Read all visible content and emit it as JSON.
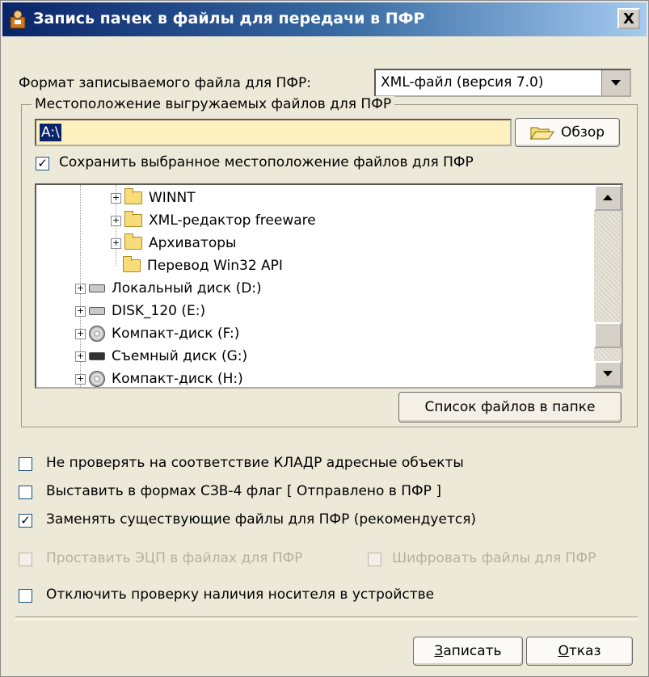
{
  "window": {
    "title": "Запись пачек в файлы для передачи в ПФР",
    "close_label": "X"
  },
  "format": {
    "label": "Формат записываемого файла для ПФР:",
    "value": "XML-файл (версия 7.0)"
  },
  "location": {
    "group_title": "Местоположение выгружаемых файлов для ПФР",
    "path_value": "A:\\",
    "browse_label": "Обзор",
    "save_location_label": "Сохранить выбранное местоположение файлов для ПФР",
    "save_location_checked": true,
    "file_list_button": "Список файлов в папке"
  },
  "tree": {
    "items": [
      {
        "label": "WINNT",
        "icon": "folder-icon",
        "expandable": true
      },
      {
        "label": "XML-редактор freeware",
        "icon": "folder-icon",
        "expandable": true
      },
      {
        "label": "Архиваторы",
        "icon": "folder-icon",
        "expandable": true
      },
      {
        "label": "Перевод Win32 API",
        "icon": "folder-icon",
        "expandable": false
      },
      {
        "label": "Локальный диск (D:)",
        "icon": "hard-drive-icon",
        "expandable": true
      },
      {
        "label": "DISK_120 (E:)",
        "icon": "hard-drive-icon",
        "expandable": true
      },
      {
        "label": "Компакт-диск (F:)",
        "icon": "cd-drive-icon",
        "expandable": true
      },
      {
        "label": "Съемный диск (G:)",
        "icon": "removable-drive-icon",
        "expandable": true
      },
      {
        "label": "Компакт-диск (H:)",
        "icon": "cd-drive-icon",
        "expandable": true
      }
    ]
  },
  "options": {
    "kladr": {
      "label": "Не проверять на соответствие КЛАДР адресные объекты",
      "checked": false
    },
    "szv4": {
      "label": "Выставить в формах СЗВ-4 флаг [ Отправлено в ПФР ]",
      "checked": false
    },
    "replace": {
      "label": "Заменять существующие файлы для ПФР (рекомендуется)",
      "checked": true
    },
    "sign": {
      "label": "Проставить ЭЦП в файлах для ПФР",
      "checked": false,
      "disabled": true
    },
    "encrypt": {
      "label": "Шифровать файлы для ПФР",
      "checked": false,
      "disabled": true
    },
    "media_check": {
      "label": "Отключить проверку наличия носителя в устройстве",
      "checked": false
    }
  },
  "buttons": {
    "write_first": "З",
    "write_rest": "аписать",
    "cancel_first": "О",
    "cancel_rest": "тказ"
  }
}
